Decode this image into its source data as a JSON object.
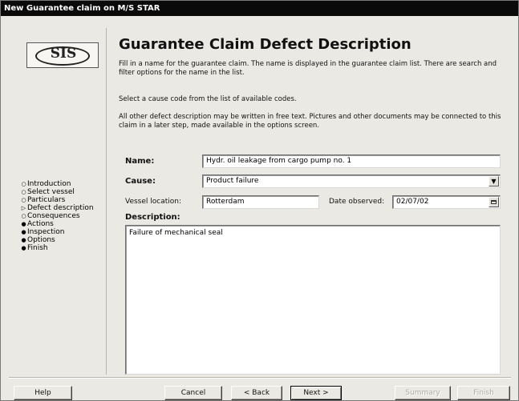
{
  "window": {
    "title": "New Guarantee claim on M/S STAR"
  },
  "logo": {
    "text": "SIS"
  },
  "sidebar": {
    "steps": [
      {
        "bullet": "○",
        "label": "Introduction"
      },
      {
        "bullet": "○",
        "label": "Select vessel"
      },
      {
        "bullet": "○",
        "label": "Particulars"
      },
      {
        "bullet": "▷",
        "label": "Defect description"
      },
      {
        "bullet": "○",
        "label": "Consequences"
      },
      {
        "bullet": "●",
        "label": "Actions"
      },
      {
        "bullet": "●",
        "label": "Inspection"
      },
      {
        "bullet": "●",
        "label": "Options"
      },
      {
        "bullet": "●",
        "label": "Finish"
      }
    ]
  },
  "main": {
    "heading": "Guarantee Claim Defect Description",
    "para1": "Fill in a name for the guarantee claim. The name is displayed in the guarantee claim list. There are search and filter options for the name in the list.",
    "para2": "Select a cause code from the list of available codes.",
    "para3": "All other defect description may be written in free text. Pictures and other documents may be connected to this claim in a later step, made available in the options screen."
  },
  "form": {
    "name_label": "Name:",
    "name_value": "Hydr. oil leakage from cargo pump no. 1",
    "cause_label": "Cause:",
    "cause_value": "Product failure",
    "location_label": "Vessel location:",
    "location_value": "Rotterdam",
    "date_label": "Date observed:",
    "date_value": "02/07/02",
    "description_label": "Description:",
    "description_value": "Failure of mechanical seal"
  },
  "buttons": {
    "help": "Help",
    "cancel": "Cancel",
    "back": "< Back",
    "next": "Next >",
    "summary": "Summary",
    "finish": "Finish"
  }
}
